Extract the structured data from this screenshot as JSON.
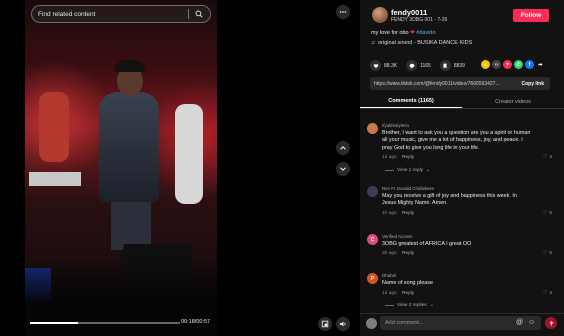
{
  "search": {
    "placeholder": "Find related content"
  },
  "player": {
    "time": "00:18/00:57",
    "progress": 0.32
  },
  "author": {
    "username": "fendy0011",
    "nickname": "FENDY 3OBG 001 · 7-26",
    "follow_label": "Follow"
  },
  "post": {
    "caption": "my love for obo",
    "caption_tag": "#davido",
    "sound": "original sound - BUSIKA DANCE KIDS"
  },
  "stats": {
    "likes": "88.3K",
    "comments": "1165",
    "saves": "8839"
  },
  "share": {
    "icons": [
      "more-share-icon",
      "embed-icon",
      "pinterest-icon",
      "whatsapp-icon",
      "facebook-icon",
      "share-forward-icon"
    ]
  },
  "link": {
    "url": "https://www.tiktok.com/@fendy0011/video/7666593427...",
    "copy_label": "Copy link"
  },
  "tabs": [
    {
      "label": "Comments (1165)"
    },
    {
      "label": "Creator videos"
    }
  ],
  "comments": [
    {
      "user": "Ifyalifestyle01",
      "text": "Brother, I want to ask you a question are you a spirit or human all your music, give me a lot of happiness, joy, and peace. I pray God to give you long life in your life.",
      "time": "1d ago",
      "reply": "Reply",
      "likes": "2",
      "replies": "View 1 reply",
      "avatar_color": "#c77b4c",
      "avatar_letter": ""
    },
    {
      "user": "Rev Fr Donald Chidiebere",
      "text": "May you receive a gift of joy and happiness this week. In Jesus Mighty Name. Amen.",
      "time": "4h ago",
      "reply": "Reply",
      "likes": "0",
      "avatar_color": "#3a3f52",
      "avatar_letter": ""
    },
    {
      "user": "Verified Access",
      "text": "3OBG greatest of AFRICA I great OO",
      "time": "3h ago",
      "reply": "Reply",
      "likes": "0",
      "avatar_color": "#e04a86",
      "avatar_letter": "C"
    },
    {
      "user": "Dhabel",
      "text": "Name of song please",
      "time": "1d ago",
      "reply": "Reply",
      "likes": "2",
      "replies": "View 2 replies",
      "avatar_color": "#d9541f",
      "avatar_letter": "P"
    }
  ],
  "composer": {
    "placeholder": "Add comment..."
  },
  "colors": {
    "accent": "#fe2c55",
    "panel": "#121212",
    "link": "#5fb0ff"
  }
}
